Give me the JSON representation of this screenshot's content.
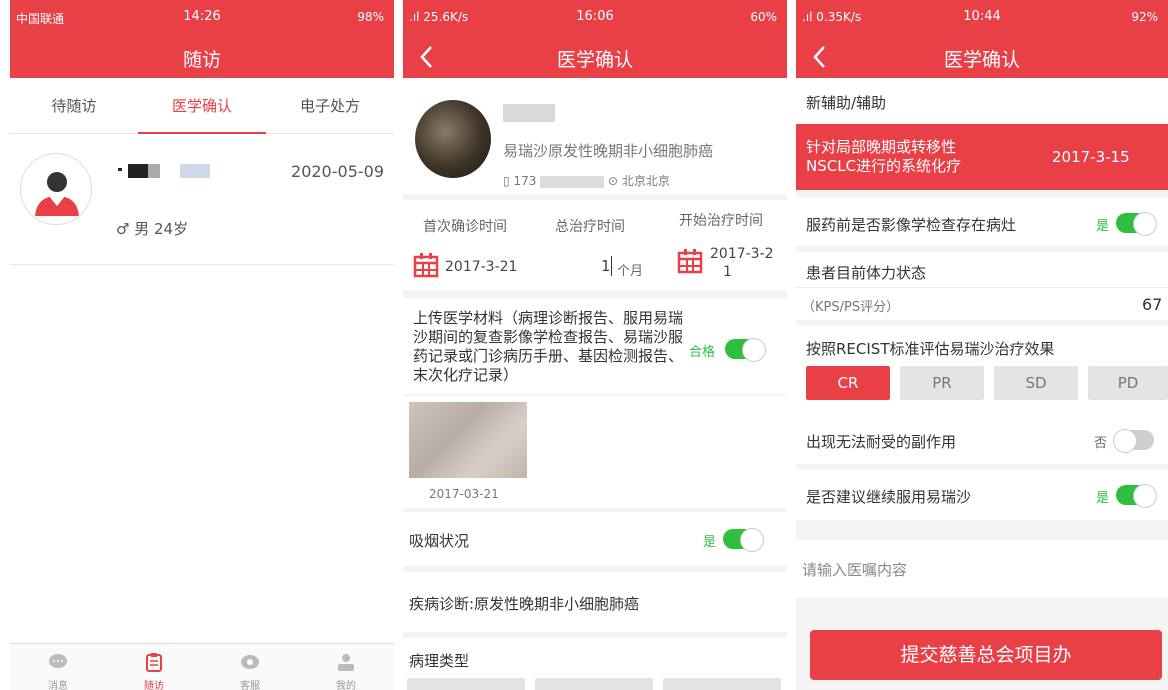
{
  "screen1": {
    "status": {
      "carrier": "中国联通",
      "time": "14:26",
      "battery": "98%"
    },
    "title": "随访",
    "tabs": [
      "待随访",
      "医学确认",
      "电子处方"
    ],
    "patient": {
      "date": "2020-05-09",
      "gender": "♂ 男 24岁"
    },
    "bottom_nav": [
      "消息",
      "随访",
      "客服",
      "我的"
    ]
  },
  "screen2": {
    "status": {
      "left": ".ıl 25.6K/s",
      "time": "16:06",
      "battery": "60%"
    },
    "title": "医学确认",
    "patient": {
      "diagnosis": "易瑞沙原发性晚期非小细胞肺癌",
      "phone_prefix": "173",
      "location": "北京北京"
    },
    "times": {
      "first_label": "首次确诊时间",
      "first_value": "2017-3-21",
      "total_label": "总治疗时间",
      "total_value": "1",
      "total_unit": "个月",
      "start_label": "开始治疗时间",
      "start_value_1": "2017-3-2",
      "start_value_2": "1"
    },
    "upload": {
      "text": "上传医学材料（病理诊断报告、服用易瑞沙期间的复查影像学检查报告、易瑞沙服药记录或门诊病历手册、基因检测报告、末次化疗记录）",
      "toggle_label": "合格",
      "image_date": "2017-03-21"
    },
    "smoking": {
      "label": "吸烟状况",
      "toggle_label": "是"
    },
    "diagnosis_line": "疾病诊断:原发性晚期非小细胞肺癌",
    "pathology": "病理类型"
  },
  "screen3": {
    "status": {
      "left": ".ıl 0.35K/s",
      "time": "10:44",
      "battery": "92%"
    },
    "title": "医学确认",
    "section": "新辅助/辅助",
    "highlight": {
      "line1": "针对局部晚期或转移性",
      "line2": "NSCLC进行的系统化疗",
      "date": "2017-3-15"
    },
    "imaging": {
      "label": "服药前是否影像学检查存在病灶",
      "toggle_label": "是"
    },
    "physical": {
      "label": "患者目前体力状态",
      "sub": "（KPS/PS评分）",
      "value": "67"
    },
    "recist": {
      "label": "按照RECIST标准评估易瑞沙治疗效果",
      "options": [
        "CR",
        "PR",
        "SD",
        "PD"
      ]
    },
    "side_effects": {
      "label": "出现无法耐受的副作用",
      "toggle_label": "否"
    },
    "continue": {
      "label": "是否建议继续服用易瑞沙",
      "toggle_label": "是"
    },
    "advice_placeholder": "请输入医嘱内容",
    "submit": "提交慈善总会项目办"
  },
  "colors": {
    "brand": "#e84046",
    "toggle_on": "#2fbf3f"
  }
}
